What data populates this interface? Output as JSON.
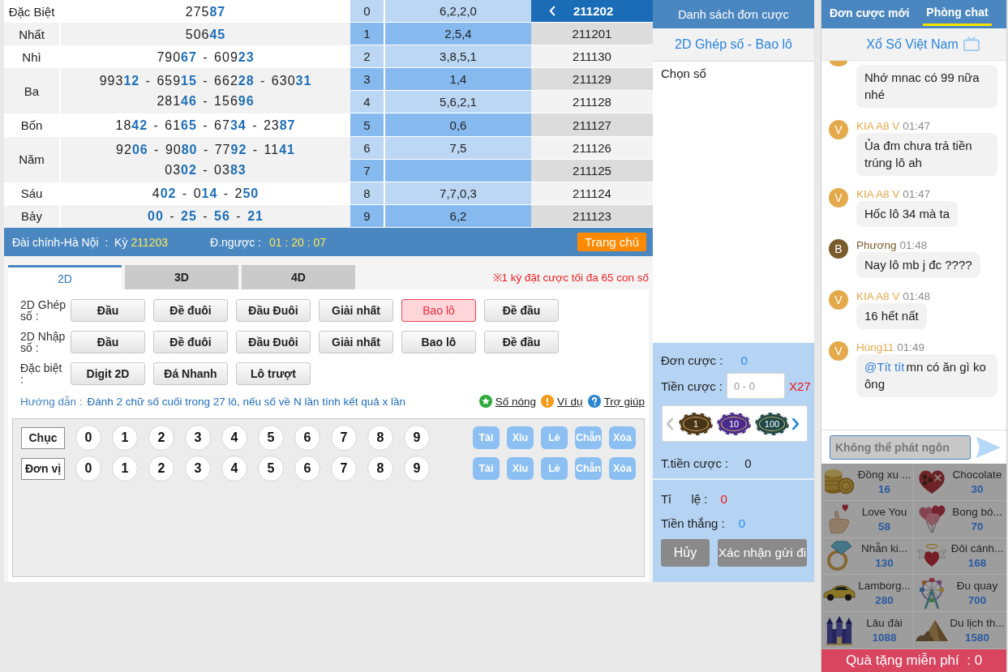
{
  "results": {
    "prizes": [
      {
        "name": "Đặc Biệt",
        "lines": [
          "275**87**"
        ]
      },
      {
        "name": "Nhất",
        "lines": [
          "506**45**"
        ]
      },
      {
        "name": "Nhì",
        "lines": [
          "790**67** - 609**23**"
        ]
      },
      {
        "name": "Ba",
        "lines": [
          "993**12** - 659**15** - 662**28** - 630**31**",
          "281**46** - 156**96**"
        ]
      },
      {
        "name": "Bốn",
        "lines": [
          "18**42** - 61**65** - 67**34** - 23**87**"
        ]
      },
      {
        "name": "Năm",
        "lines": [
          "92**06** - 90**80** - 77**92** - 11**41**",
          "03**02** - 03**83**"
        ]
      },
      {
        "name": "Sáu",
        "lines": [
          "4**02** - 0**14** - 2**50**"
        ]
      },
      {
        "name": "Bảy",
        "lines": [
          "**00** - **25** - **56** - **21**"
        ]
      }
    ]
  },
  "tails": [
    {
      "digit": "0",
      "values": "6,2,2,0"
    },
    {
      "digit": "1",
      "values": "2,5,4"
    },
    {
      "digit": "2",
      "values": "3,8,5,1"
    },
    {
      "digit": "3",
      "values": "1,4"
    },
    {
      "digit": "4",
      "values": "5,6,2,1"
    },
    {
      "digit": "5",
      "values": "0,6"
    },
    {
      "digit": "6",
      "values": "7,5"
    },
    {
      "digit": "7"
    },
    {
      "digit": "8",
      "values": "7,7,0,3"
    },
    {
      "digit": "9",
      "values": "6,2"
    }
  ],
  "periods": [
    {
      "label": "211202",
      "selected": true
    },
    {
      "label": "211201",
      "selected": false
    },
    {
      "label": "211130",
      "selected": false
    },
    {
      "label": "211129",
      "selected": false
    },
    {
      "label": "211128",
      "selected": false
    },
    {
      "label": "211127",
      "selected": false
    },
    {
      "label": "211126",
      "selected": false
    },
    {
      "label": "211125",
      "selected": false
    },
    {
      "label": "211124",
      "selected": false
    },
    {
      "label": "211123",
      "selected": false
    }
  ],
  "draw_info": {
    "station": "Đài chính-Hà Nội  :  Kỳ",
    "period": "211203",
    "countdown_label": "Đ.ngược :",
    "countdown": "01 : 20 : 07",
    "home_button": "Trang chủ"
  },
  "bet": {
    "tabs": [
      {
        "label": "2D",
        "selected": true
      },
      {
        "label": "3D",
        "selected": false
      },
      {
        "label": "4D",
        "selected": false
      }
    ],
    "limit_note": "※1 kỳ đặt cược tối đa 65 con số",
    "groups": [
      {
        "label": "2D Ghép số :",
        "options": [
          {
            "label": "Đầu",
            "selected": false
          },
          {
            "label": "Đề đuôi",
            "selected": false
          },
          {
            "label": "Đầu Đuôi",
            "selected": false
          },
          {
            "label": "Giải nhất",
            "selected": false
          },
          {
            "label": "Bao lô",
            "selected": true
          },
          {
            "label": "Đề đầu",
            "selected": false
          }
        ]
      },
      {
        "label": "2D Nhập số :",
        "options": [
          {
            "label": "Đầu",
            "selected": false
          },
          {
            "label": "Đề đuôi",
            "selected": false
          },
          {
            "label": "Đầu Đuôi",
            "selected": false
          },
          {
            "label": "Giải nhất",
            "selected": false
          },
          {
            "label": "Bao lô",
            "selected": false
          },
          {
            "label": "Đề đầu",
            "selected": false
          }
        ]
      },
      {
        "label": "Đặc biệt :",
        "options": [
          {
            "label": "Digit 2D",
            "selected": false
          },
          {
            "label": "Đá Nhanh",
            "selected": false
          },
          {
            "label": "Lô trượt",
            "selected": false
          }
        ]
      }
    ],
    "guide_label": "Hướng dẫn :",
    "guide_text": "Đánh 2 chữ số cuối trong 27 lô, nếu số về N lần tính kết quả x lần",
    "links": [
      "Số nóng",
      "Ví dụ",
      "Trợ giúp"
    ],
    "pad": [
      {
        "label": "Chục",
        "digits": [
          {
            "label": "0",
            "selected": false
          },
          {
            "label": "1",
            "selected": false
          },
          {
            "label": "2",
            "selected": false
          },
          {
            "label": "3",
            "selected": false
          },
          {
            "label": "4",
            "selected": false
          },
          {
            "label": "5",
            "selected": false
          },
          {
            "label": "6",
            "selected": false
          },
          {
            "label": "7",
            "selected": false
          },
          {
            "label": "8",
            "selected": false
          },
          {
            "label": "9",
            "selected": false
          }
        ],
        "actions": [
          "Tài",
          "Xỉu",
          "Lẻ",
          "Chẵn",
          "Xóa"
        ]
      },
      {
        "label": "Đơn vị",
        "digits": [
          {
            "label": "0",
            "selected": false
          },
          {
            "label": "1",
            "selected": false
          },
          {
            "label": "2",
            "selected": false
          },
          {
            "label": "3",
            "selected": false
          },
          {
            "label": "4",
            "selected": false
          },
          {
            "label": "5",
            "selected": false
          },
          {
            "label": "6",
            "selected": false
          },
          {
            "label": "7",
            "selected": false
          },
          {
            "label": "8",
            "selected": false
          },
          {
            "label": "9",
            "selected": false
          }
        ],
        "actions": [
          "Tài",
          "Xỉu",
          "Lẻ",
          "Chẵn",
          "Xóa"
        ]
      }
    ]
  },
  "order_panel": {
    "title": "Danh sách đơn cược",
    "bet_type": "2D Ghép số - Bao lô",
    "pick_label": "Chọn số",
    "order_count_label": "Đơn cược :",
    "order_count": "0",
    "stake_label": "Tiền cược :",
    "stake_placeholder": "0 - 0",
    "multiplier": "X27",
    "chips": [
      {
        "label": "1",
        "color": "#4a3416"
      },
      {
        "label": "10",
        "color": "#4a2a8c"
      },
      {
        "label": "100",
        "color": "#1d4848"
      }
    ],
    "total_label": "T.tiền cược :",
    "total": "0",
    "odds_label": "Tỉ      lệ :",
    "odds": "0",
    "win_label": "Tiền thắng :",
    "win": "0",
    "buttons": [
      "Hủy",
      "Xác nhận gửi đi"
    ]
  },
  "chat": {
    "tabs": [
      {
        "label": "Đơn cược mới",
        "selected": false
      },
      {
        "label": "Phòng chat",
        "selected": true
      }
    ],
    "room": "Xổ Số Việt Nam",
    "messages": [
      {
        "color": "#e4a94b",
        "text": "Nhớ mnac có 99 nữa nhé"
      },
      {
        "avatar": "V",
        "color": "#e4a94b",
        "name": "KIA A8 V",
        "time": "01:47",
        "text": "Ủa đm chưa trả tiền trúng lô ah"
      },
      {
        "avatar": "V",
        "color": "#e4a94b",
        "name": "KIA A8 V",
        "time": "01:47",
        "text": "Hốc lô 34 mà ta"
      },
      {
        "avatar": "B",
        "color": "#7b5a2c",
        "name": "Phương",
        "time": "01:48",
        "text": "Nay lô mb j đc ????"
      },
      {
        "avatar": "V",
        "color": "#e4a94b",
        "name": "KIA A8 V",
        "time": "01:48",
        "text": "16 hết nất"
      },
      {
        "avatar": "V",
        "color": "#e4a94b",
        "name": "Hùng11",
        "time": "01:49",
        "mention": "@Tít tít",
        "text": "mn có ăn gì ko ông"
      }
    ],
    "input": {
      "placeholder": "Không thể phát ngôn",
      "disabled": true
    }
  },
  "gifts": {
    "items": [
      {
        "name": "Đồng xu ...",
        "price": "16"
      },
      {
        "name": "Chocolate",
        "price": "30"
      },
      {
        "name": "Love You",
        "price": "58"
      },
      {
        "name": "Bong bó...",
        "price": "70"
      },
      {
        "name": "Nhẫn ki...",
        "price": "130"
      },
      {
        "name": "Đôi cánh...",
        "price": "168"
      },
      {
        "name": "Lamborg...",
        "price": "280"
      },
      {
        "name": "Đu quay",
        "price": "700"
      },
      {
        "name": "Lâu đài",
        "price": "1088"
      },
      {
        "name": "Du lịch th...",
        "price": "1580"
      }
    ],
    "free": "Quà tặng miễn phí  : 0"
  }
}
